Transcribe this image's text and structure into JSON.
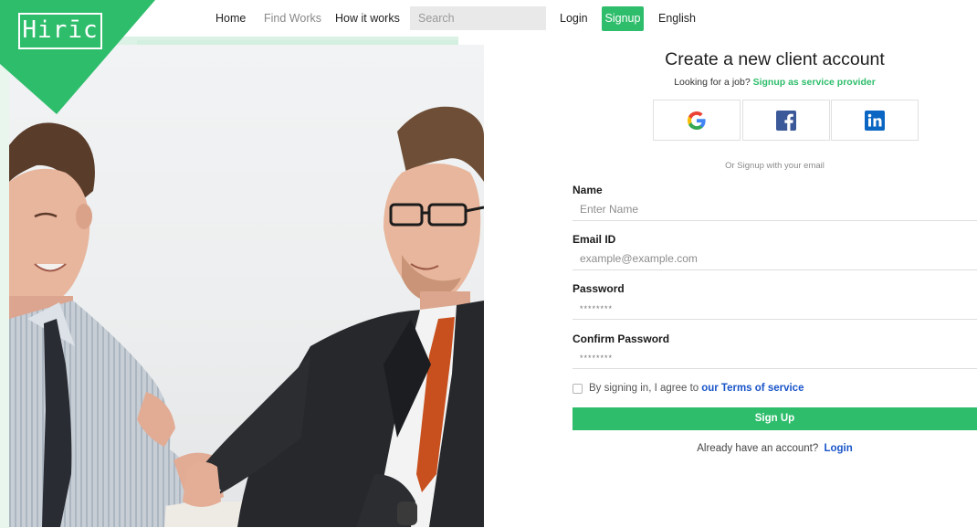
{
  "brand": {
    "logo_text": "Hirīc",
    "accent_color": "#2ebd6b"
  },
  "nav": {
    "links": [
      "Home",
      "Find Works",
      "How it works"
    ],
    "search_placeholder": "Search",
    "login": "Login",
    "signup": "Signup",
    "language": "English"
  },
  "form": {
    "title": "Create a new client account",
    "subtitle_prefix": "Looking for a job?",
    "subtitle_link": "Signup as service provider",
    "social": [
      {
        "name": "google",
        "icon": "google-icon"
      },
      {
        "name": "facebook",
        "icon": "facebook-icon"
      },
      {
        "name": "linkedin",
        "icon": "linkedin-icon"
      }
    ],
    "divider_text": "Or Signup with your email",
    "fields": [
      {
        "label": "Name",
        "placeholder": "Enter Name",
        "value": ""
      },
      {
        "label": "Email ID",
        "placeholder": "example@example.com",
        "value": ""
      },
      {
        "label": "Password",
        "placeholder": "********",
        "value": ""
      },
      {
        "label": "Confirm Password",
        "placeholder": "********",
        "value": ""
      }
    ],
    "terms_prefix": "By signing in, I agree to",
    "terms_link": "our Terms of service",
    "terms_checked": false,
    "submit": "Sign Up",
    "login_prefix": "Already have an account?",
    "login_link": "Login"
  }
}
